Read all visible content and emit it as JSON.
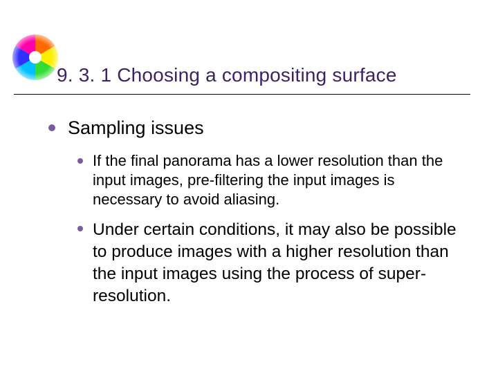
{
  "title": "9. 3. 1 Choosing a compositing surface",
  "bullets": {
    "lvl1": "Sampling issues",
    "lvl2": [
      "If the final panorama has a lower resolution than the input images, pre-filtering the input images is necessary to avoid aliasing.",
      "Under certain conditions, it may also be possible to produce images with a higher resolution than the input images using the process of super-resolution."
    ]
  }
}
